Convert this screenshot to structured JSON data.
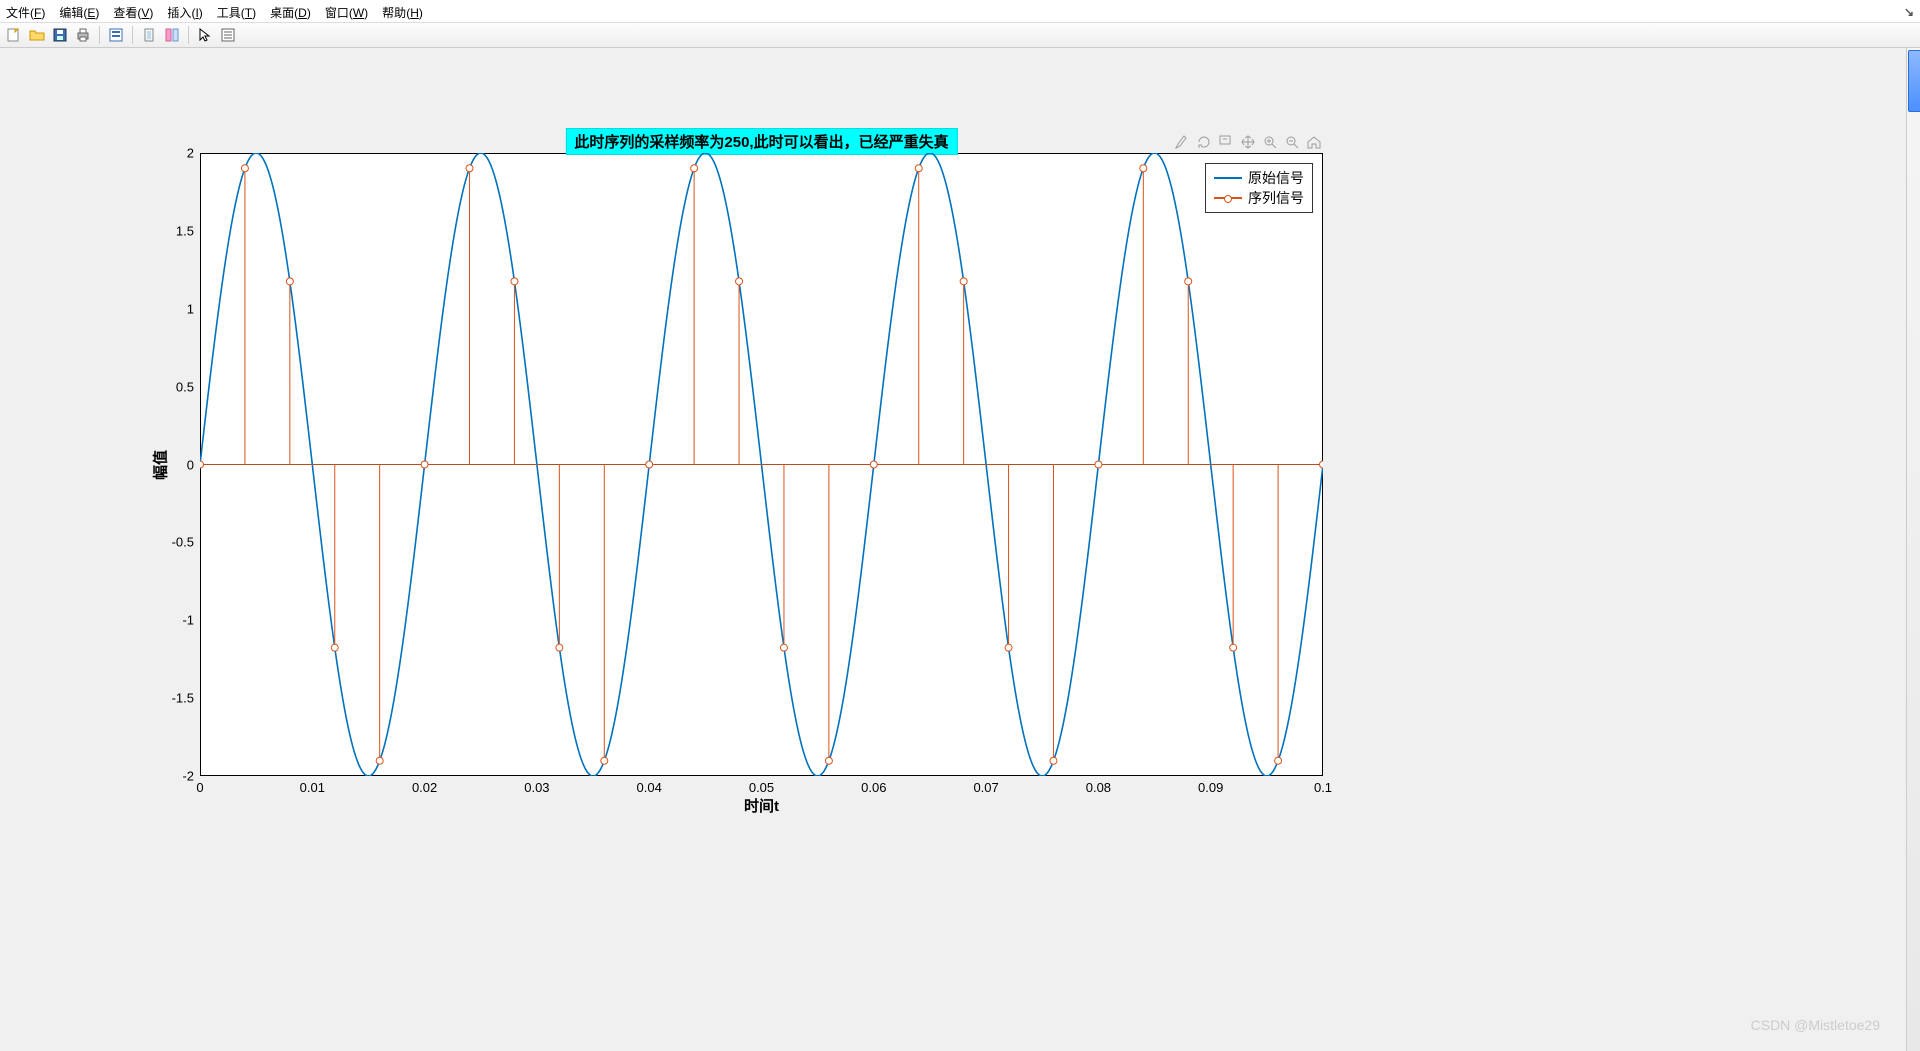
{
  "menu": {
    "file": {
      "label": "文件",
      "hot": "F"
    },
    "edit": {
      "label": "编辑",
      "hot": "E"
    },
    "view": {
      "label": "查看",
      "hot": "V"
    },
    "insert": {
      "label": "插入",
      "hot": "I"
    },
    "tools": {
      "label": "工具",
      "hot": "T"
    },
    "desktop": {
      "label": "桌面",
      "hot": "D"
    },
    "window": {
      "label": "窗口",
      "hot": "W"
    },
    "help": {
      "label": "帮助",
      "hot": "H"
    }
  },
  "toolbar_icons": [
    "new",
    "open",
    "save",
    "print",
    "|",
    "print-fig",
    "|",
    "link",
    "dock",
    "|",
    "pointer",
    "inspector"
  ],
  "axes_tools": [
    "brush",
    "rotate",
    "panbox",
    "pan",
    "zoom-in",
    "zoom-out",
    "home"
  ],
  "chart_data": {
    "type": "line+stem",
    "title": "此时序列的采样频率为250,此时可以看出，已经严重失真",
    "xlabel": "时间t",
    "ylabel": "幅值",
    "xlim": [
      0,
      0.1
    ],
    "ylim": [
      -2,
      2
    ],
    "xticks": [
      0,
      0.01,
      0.02,
      0.03,
      0.04,
      0.05,
      0.06,
      0.07,
      0.08,
      0.09,
      0.1
    ],
    "yticks": [
      -2,
      -1.5,
      -1,
      -0.5,
      0,
      0.5,
      1,
      1.5,
      2
    ],
    "legend": [
      "原始信号",
      "序列信号"
    ],
    "colors": {
      "original": "#0072BD",
      "sampled": "#D95319"
    },
    "continuous": {
      "desc": "y = 2*sin(2*pi*50*t), t in [0,0.1]",
      "amplitude": 2,
      "frequency_hz": 50
    },
    "sampled": {
      "fs_hz": 250,
      "t": [
        0.0,
        0.004,
        0.008,
        0.012,
        0.016,
        0.02,
        0.024,
        0.028,
        0.032,
        0.036,
        0.04,
        0.044,
        0.048,
        0.052,
        0.056,
        0.06,
        0.064,
        0.068,
        0.072,
        0.076,
        0.08,
        0.084,
        0.088,
        0.092,
        0.096,
        0.1
      ],
      "y": [
        0.0,
        1.902,
        1.176,
        -1.176,
        -1.902,
        0.0,
        1.902,
        1.176,
        -1.176,
        -1.902,
        0.0,
        1.902,
        1.176,
        -1.176,
        -1.902,
        0.0,
        1.902,
        1.176,
        -1.176,
        -1.902,
        0.0,
        1.902,
        1.176,
        -1.176,
        -1.902,
        0.0
      ]
    }
  },
  "watermark": "CSDN @Mistletoe29"
}
